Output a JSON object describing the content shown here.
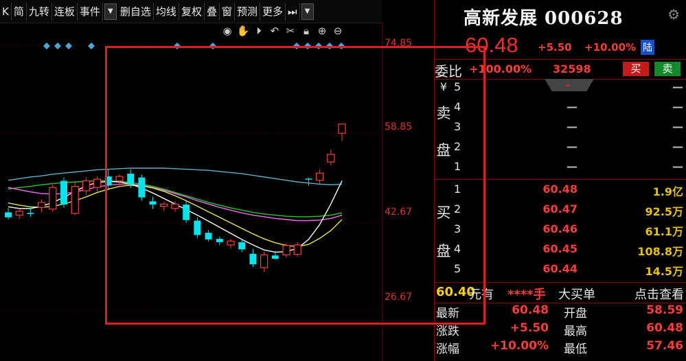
{
  "toolbar": {
    "items": [
      "K",
      "简",
      "九转",
      "连板",
      "事件",
      "▼",
      "删自选",
      "均线",
      "复权",
      "叠",
      "窗",
      "预测",
      "更多",
      "⏭",
      "▼"
    ]
  },
  "chart_icons": [
    "eye-icon",
    "hand-icon",
    "play-icon",
    "undo-icon",
    "scissors-icon",
    "lock-icon",
    "zoom-in-icon",
    "zoom-out-icon"
  ],
  "axis": {
    "labels": [
      "74.85",
      "58.85",
      "42.67",
      "26.67"
    ]
  },
  "stock": {
    "name_code": "高新发展 000628",
    "price": "60.48",
    "change": "+5.50",
    "change_pct": "+10.00%",
    "market_badge": "陆"
  },
  "webi": {
    "label": "委比",
    "ratio": "+100.00%",
    "diff": "32598",
    "sell_btn": "买",
    "buy_btn": "卖"
  },
  "ask": {
    "currency": "¥",
    "side_label": [
      "卖",
      "盘"
    ],
    "levels": [
      {
        "lvl": "5",
        "price": "",
        "vol": "—"
      },
      {
        "lvl": "4",
        "price": "—",
        "vol": "—"
      },
      {
        "lvl": "3",
        "price": "—",
        "vol": "—"
      },
      {
        "lvl": "2",
        "price": "—",
        "vol": "—"
      },
      {
        "lvl": "1",
        "price": "—",
        "vol": "—"
      }
    ]
  },
  "bid": {
    "side_label": [
      "买",
      "盘"
    ],
    "levels": [
      {
        "lvl": "1",
        "price": "60.48",
        "vol": "1.9亿"
      },
      {
        "lvl": "2",
        "price": "60.47",
        "vol": "92.5万"
      },
      {
        "lvl": "3",
        "price": "60.46",
        "vol": "61.1万"
      },
      {
        "lvl": "4",
        "price": "60.45",
        "vol": "108.8万"
      },
      {
        "lvl": "5",
        "price": "60.44",
        "vol": "14.5万"
      }
    ]
  },
  "bigorder": {
    "price": "60.40",
    "unit": "元有",
    "hand": "****手",
    "label": "大买单",
    "link": "点击查看"
  },
  "quote": [
    {
      "l1": "最新",
      "v1": "60.48",
      "l2": "开盘",
      "v2": "58.59"
    },
    {
      "l1": "涨跌",
      "v1": "+5.50",
      "l2": "最高",
      "v2": "60.48"
    },
    {
      "l1": "涨幅",
      "v1": "+10.00%",
      "l2": "最低",
      "v2": "57.46"
    }
  ],
  "colors": {
    "up": "#ff3b3b",
    "down": "#00e5ee",
    "ma5": "#ffffff",
    "ma10": "#e8e840",
    "ma20": "#ff66ff",
    "ma30": "#22cc22",
    "ma60": "#5fb0c8"
  },
  "chart_data": {
    "type": "candlestick",
    "ylim": [
      26.67,
      74.85
    ],
    "candles": [
      {
        "o": 44.5,
        "h": 45.3,
        "l": 43.2,
        "c": 43.6
      },
      {
        "o": 44.0,
        "h": 45.2,
        "l": 43.3,
        "c": 44.7
      },
      {
        "o": 44.4,
        "h": 45.6,
        "l": 43.7,
        "c": 44.2
      },
      {
        "o": 45.4,
        "h": 46.8,
        "l": 44.5,
        "c": 46.3
      },
      {
        "o": 45.1,
        "h": 49.5,
        "l": 44.6,
        "c": 49.0
      },
      {
        "o": 50.2,
        "h": 50.8,
        "l": 45.3,
        "c": 45.9
      },
      {
        "o": 44.3,
        "h": 50.0,
        "l": 44.0,
        "c": 49.2
      },
      {
        "o": 48.4,
        "h": 50.8,
        "l": 47.6,
        "c": 50.2
      },
      {
        "o": 49.0,
        "h": 51.0,
        "l": 48.3,
        "c": 50.5
      },
      {
        "o": 51.0,
        "h": 52.3,
        "l": 48.5,
        "c": 49.4
      },
      {
        "o": 50.2,
        "h": 51.4,
        "l": 49.0,
        "c": 51.0
      },
      {
        "o": 51.5,
        "h": 52.3,
        "l": 48.9,
        "c": 49.5
      },
      {
        "o": 50.8,
        "h": 51.3,
        "l": 46.6,
        "c": 47.2
      },
      {
        "o": 46.5,
        "h": 47.3,
        "l": 45.1,
        "c": 45.9
      },
      {
        "o": 45.6,
        "h": 46.4,
        "l": 44.8,
        "c": 46.0
      },
      {
        "o": 45.2,
        "h": 46.5,
        "l": 44.6,
        "c": 46.0
      },
      {
        "o": 45.9,
        "h": 46.5,
        "l": 42.6,
        "c": 43.1
      },
      {
        "o": 43.0,
        "h": 43.6,
        "l": 39.8,
        "c": 40.4
      },
      {
        "o": 40.8,
        "h": 41.3,
        "l": 39.2,
        "c": 39.6
      },
      {
        "o": 39.7,
        "h": 40.1,
        "l": 38.6,
        "c": 39.1
      },
      {
        "o": 38.6,
        "h": 39.7,
        "l": 38.0,
        "c": 39.3
      },
      {
        "o": 39.1,
        "h": 39.6,
        "l": 37.3,
        "c": 37.8
      },
      {
        "o": 37.0,
        "h": 37.9,
        "l": 34.6,
        "c": 35.1
      },
      {
        "o": 34.5,
        "h": 37.4,
        "l": 33.7,
        "c": 36.8
      },
      {
        "o": 36.7,
        "h": 37.5,
        "l": 36.0,
        "c": 36.1
      },
      {
        "o": 36.8,
        "h": 38.9,
        "l": 36.3,
        "c": 38.5
      },
      {
        "o": 36.9,
        "h": 39.1,
        "l": 36.5,
        "c": 38.6
      },
      {
        "o": 50.6,
        "h": 50.8,
        "l": 49.3,
        "c": 50.5
      },
      {
        "o": 50.3,
        "h": 52.3,
        "l": 49.6,
        "c": 51.6
      },
      {
        "o": 53.6,
        "h": 55.8,
        "l": 53.0,
        "c": 55.0
      },
      {
        "o": 58.8,
        "h": 60.48,
        "l": 57.46,
        "c": 60.48
      }
    ],
    "ma_series": [
      {
        "key": "ma60",
        "values": [
          50.3,
          50.6,
          50.9,
          51.1,
          51.4,
          51.6,
          51.8,
          52.0,
          52.2,
          52.3,
          52.4,
          52.5,
          52.5,
          52.5,
          52.5,
          52.4,
          52.3,
          52.2,
          52.1,
          51.9,
          51.7,
          51.5,
          51.2,
          50.9,
          50.6,
          50.3,
          50.0,
          49.8,
          49.6,
          49.5,
          49.6
        ]
      },
      {
        "key": "ma30",
        "values": [
          48.7,
          49.0,
          49.2,
          49.5,
          49.7,
          49.9,
          50.0,
          50.1,
          50.2,
          50.2,
          50.1,
          49.9,
          49.6,
          49.2,
          48.7,
          48.1,
          47.5,
          46.9,
          46.3,
          45.8,
          45.3,
          44.9,
          44.5,
          44.2,
          44.0,
          43.8,
          43.7,
          43.7,
          43.8,
          44.0,
          44.4
        ]
      },
      {
        "key": "ma20",
        "values": [
          49.0,
          48.6,
          48.2,
          47.9,
          47.8,
          47.9,
          48.2,
          48.6,
          49.1,
          49.4,
          49.6,
          49.6,
          49.4,
          49.0,
          48.5,
          47.9,
          47.3,
          46.6,
          46.0,
          45.4,
          44.9,
          44.4,
          44.0,
          43.7,
          43.4,
          43.2,
          43.0,
          43.0,
          43.1,
          43.4,
          44.0
        ]
      },
      {
        "key": "ma10",
        "values": [
          46.2,
          45.8,
          45.5,
          45.4,
          45.6,
          46.0,
          46.6,
          47.3,
          48.1,
          48.7,
          49.2,
          49.4,
          49.3,
          48.9,
          48.3,
          47.5,
          46.6,
          45.6,
          44.6,
          43.6,
          42.6,
          41.6,
          40.6,
          39.7,
          39.0,
          38.5,
          38.3,
          38.7,
          39.8,
          41.2,
          43.2
        ]
      },
      {
        "key": "ma5",
        "values": [
          45.5,
          45.2,
          45.2,
          45.6,
          46.3,
          47.2,
          48.3,
          49.3,
          49.9,
          50.1,
          50.0,
          49.6,
          48.9,
          48.0,
          47.0,
          46.0,
          45.0,
          44.0,
          42.9,
          41.8,
          40.7,
          39.6,
          38.6,
          37.7,
          37.3,
          37.4,
          38.0,
          39.6,
          42.3,
          46.0,
          50.2
        ]
      }
    ]
  }
}
